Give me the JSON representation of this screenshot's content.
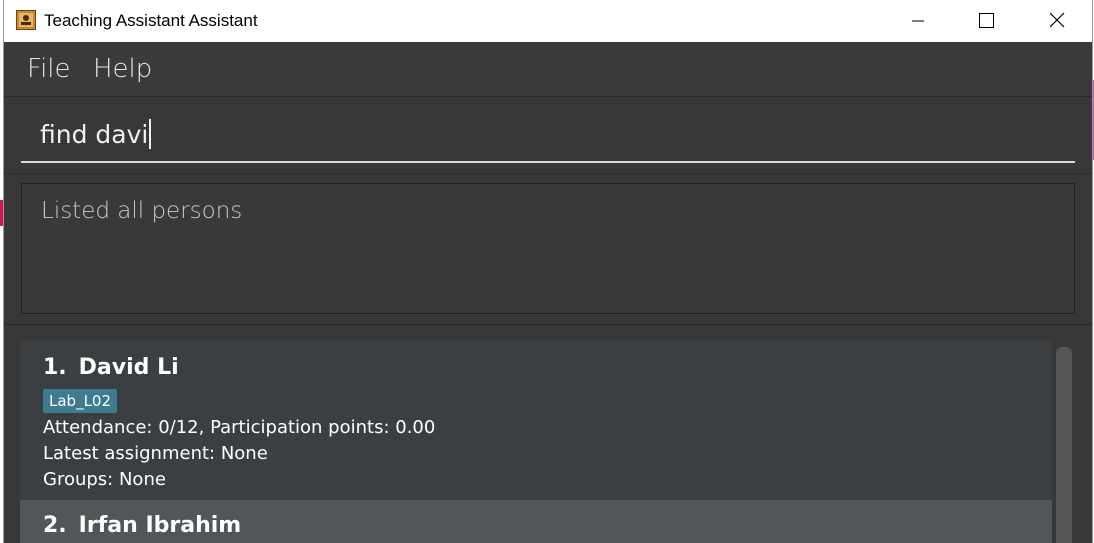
{
  "window": {
    "title": "Teaching Assistant Assistant"
  },
  "menu": {
    "items": [
      "File",
      "Help"
    ]
  },
  "command": {
    "value": "find davi"
  },
  "result": {
    "message": "Listed all persons"
  },
  "persons": [
    {
      "index": "1.",
      "name": "David Li",
      "tag": "Lab_L02",
      "attendance": "Attendance: 0/12, Participation points: 0.00",
      "assignment": "Latest assignment: None",
      "groups": "Groups: None"
    },
    {
      "index": "2.",
      "name": "Irfan Ibrahim"
    }
  ],
  "colors": {
    "window_bg": "#383838",
    "card_selected": "#3c3f41",
    "card_alt": "#515658",
    "tag_bg": "#3e7b91"
  }
}
